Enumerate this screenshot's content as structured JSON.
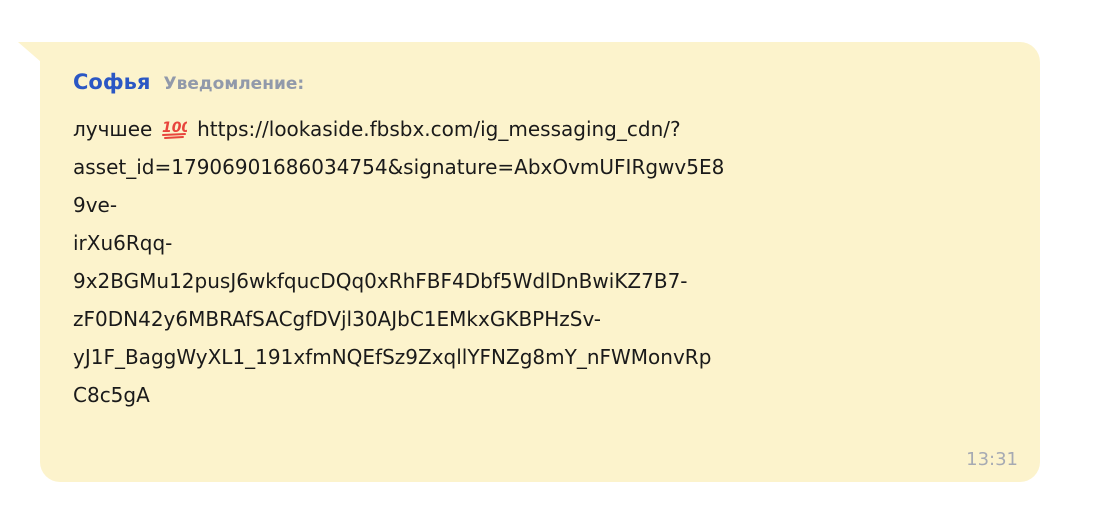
{
  "message": {
    "sender": "Софья",
    "subtitle": "Уведомление:",
    "text_prefix": "лучшее",
    "emoji": "hundred-points-icon",
    "url_first": "https://lookaside.fbsbx.com/ig_messaging_cdn/?",
    "lines": [
      "asset_id=17906901686034754&signature=AbxOvmUFIRgwv5E8",
      "9ve-",
      "irXu6Rqq-",
      "9x2BGMu12pusJ6wkfqucDQq0xRhFBF4Dbf5WdlDnBwiKZ7B7-",
      "zF0DN42y6MBRAfSACgfDVjl30AJbC1EMkxGKBPHzSv-",
      "yJ1F_BaggWyXL1_191xfmNQEfSz9ZxqllYFNZg8mY_nFWMonvRp",
      "C8c5gA"
    ],
    "time": "13:31"
  },
  "colors": {
    "bubble": "#fcf3cc",
    "sender": "#2b57c4",
    "subtitle": "#9199aa",
    "time": "#a6aab3",
    "emoji": "#e8453c"
  }
}
